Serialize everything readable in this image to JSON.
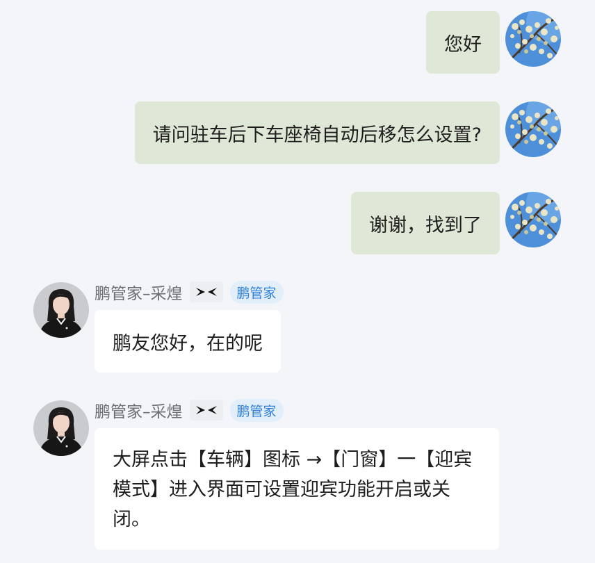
{
  "messages": {
    "user": [
      {
        "text": "您好"
      },
      {
        "text": "请问驻车后下车座椅自动后移怎么设置?"
      },
      {
        "text": "谢谢，找到了"
      }
    ],
    "agent": [
      {
        "name": "鹏管家–采煌",
        "badge": "鹏管家",
        "text": "鹏友您好，在的呢"
      },
      {
        "name": "鹏管家–采煌",
        "badge": "鹏管家",
        "text": "大屏点击【车辆】图标 →【门窗】一【迎宾模式】进入界面可设置迎宾功能开启或关闭。"
      }
    ]
  },
  "icons": {
    "user_avatar": "blossom-sky-avatar-icon",
    "agent_avatar": "agent-portrait-avatar-icon",
    "brand": "xpeng-logo-icon"
  },
  "colors": {
    "background": "#f4f5f9",
    "user_bubble": "#dfe8d6",
    "agent_bubble": "#ffffff",
    "badge_text": "#2f80d8",
    "badge_bg": "#e3eefb"
  }
}
